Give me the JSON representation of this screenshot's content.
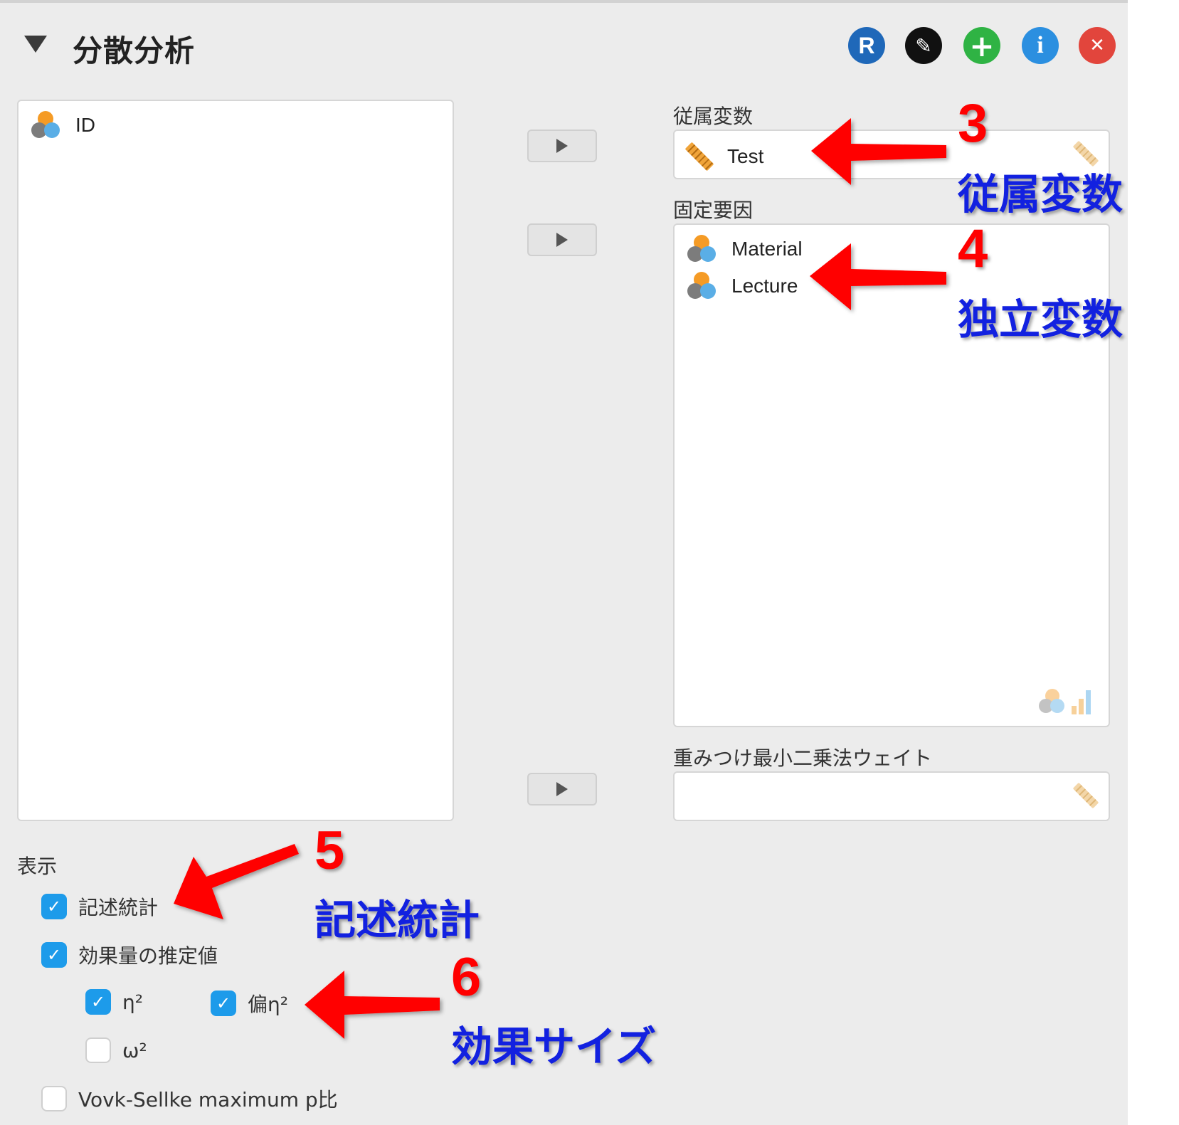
{
  "header": {
    "title": "分散分析",
    "buttons": [
      {
        "name": "r-syntax-button",
        "glyph": "R",
        "color": "#1f68b9"
      },
      {
        "name": "edit-button",
        "glyph": "✎",
        "color": "#111111"
      },
      {
        "name": "add-button",
        "glyph": "+",
        "color": "#2fb344"
      },
      {
        "name": "info-button",
        "glyph": "i",
        "color": "#2b8fe0"
      },
      {
        "name": "close-button",
        "glyph": "✕",
        "color": "#e2453c"
      }
    ]
  },
  "source_list": {
    "items": [
      {
        "label": "ID",
        "icon": "nominal-icon"
      }
    ]
  },
  "dependent": {
    "label": "従属変数",
    "items": [
      {
        "label": "Test",
        "icon": "scale-ruler-icon"
      }
    ]
  },
  "fixed_factors": {
    "label": "固定要因",
    "items": [
      {
        "label": "Material",
        "icon": "nominal-icon"
      },
      {
        "label": "Lecture",
        "icon": "nominal-icon"
      }
    ]
  },
  "wls_weights": {
    "label": "重みつけ最小二乗法ウェイト"
  },
  "display": {
    "label": "表示",
    "descriptives": {
      "label": "記述統計",
      "checked": true
    },
    "effect_size": {
      "label": "効果量の推定値",
      "checked": true
    },
    "eta2": {
      "label": "η²",
      "checked": true
    },
    "partial_eta2": {
      "label": "偏η²",
      "checked": true
    },
    "omega2": {
      "label": "ω²",
      "checked": false
    },
    "vovk": {
      "label": "Vovk-Sellke maximum p比",
      "checked": false
    }
  },
  "annotations": {
    "a3": {
      "num": "3",
      "text": "従属変数"
    },
    "a4": {
      "num": "4",
      "text": "独立変数"
    },
    "a5": {
      "num": "5",
      "text": "記述統計"
    },
    "a6": {
      "num": "6",
      "text": "効果サイズ"
    },
    "color_num": "#ff0000",
    "color_text": "#1221e0"
  }
}
